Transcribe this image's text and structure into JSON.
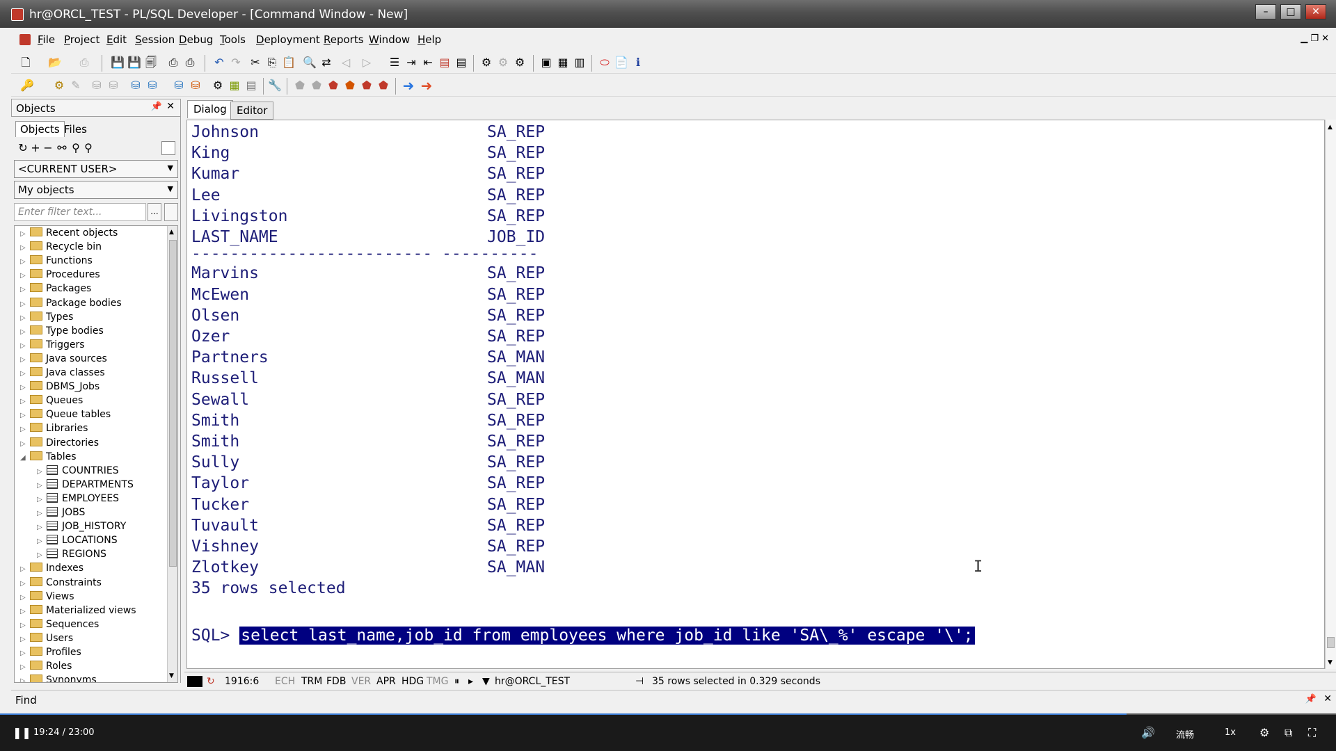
{
  "window": {
    "title": "hr@ORCL_TEST - PL/SQL Developer - [Command Window - New]"
  },
  "menu": [
    "File",
    "Project",
    "Edit",
    "Session",
    "Debug",
    "Tools",
    "Deployment",
    "Reports",
    "Window",
    "Help"
  ],
  "left_panel": {
    "title": "Objects",
    "tabs": [
      "Objects",
      "Files"
    ],
    "user_combo": "<CURRENT USER>",
    "scope_combo": "My objects",
    "filter_placeholder": "Enter filter text...",
    "filter_button": "...",
    "tree": [
      "Recent objects",
      "Recycle bin",
      "Functions",
      "Procedures",
      "Packages",
      "Package bodies",
      "Types",
      "Type bodies",
      "Triggers",
      "Java sources",
      "Java classes",
      "DBMS_Jobs",
      "Queues",
      "Queue tables",
      "Libraries",
      "Directories",
      "Tables"
    ],
    "tables": [
      "COUNTRIES",
      "DEPARTMENTS",
      "EMPLOYEES",
      "JOBS",
      "JOB_HISTORY",
      "LOCATIONS",
      "REGIONS"
    ],
    "tree_after": [
      "Indexes",
      "Constraints",
      "Views",
      "Materialized views",
      "Sequences",
      "Users",
      "Profiles",
      "Roles",
      "Synonyms"
    ]
  },
  "editor": {
    "tabs": [
      "Dialog",
      "Editor"
    ],
    "rows_top": [
      [
        "Johnson",
        "SA_REP"
      ],
      [
        "King",
        "SA_REP"
      ],
      [
        "Kumar",
        "SA_REP"
      ],
      [
        "Lee",
        "SA_REP"
      ],
      [
        "Livingston",
        "SA_REP"
      ]
    ],
    "header": [
      "LAST_NAME",
      "JOB_ID"
    ],
    "divider": "------------------------- ----------",
    "rows_bottom": [
      [
        "Marvins",
        "SA_REP"
      ],
      [
        "McEwen",
        "SA_REP"
      ],
      [
        "Olsen",
        "SA_REP"
      ],
      [
        "Ozer",
        "SA_REP"
      ],
      [
        "Partners",
        "SA_MAN"
      ],
      [
        "Russell",
        "SA_MAN"
      ],
      [
        "Sewall",
        "SA_REP"
      ],
      [
        "Smith",
        "SA_REP"
      ],
      [
        "Smith",
        "SA_REP"
      ],
      [
        "Sully",
        "SA_REP"
      ],
      [
        "Taylor",
        "SA_REP"
      ],
      [
        "Tucker",
        "SA_REP"
      ],
      [
        "Tuvault",
        "SA_REP"
      ],
      [
        "Vishney",
        "SA_REP"
      ],
      [
        "Zlotkey",
        "SA_MAN"
      ]
    ],
    "summary": "35 rows selected",
    "prompt": "SQL> ",
    "command": "select last_name,job_id from employees where job_id like 'SA\\_%' escape '\\';"
  },
  "status": {
    "position": "1916:6",
    "flags": [
      "ECH",
      "TRM",
      "FDB",
      "VER",
      "APR",
      "HDG",
      "TMG"
    ],
    "connection": "hr@ORCL_TEST",
    "message": "35 rows selected in 0.329 seconds"
  },
  "find": {
    "label": "Find"
  },
  "player": {
    "time": "19:24 / 23:00",
    "progress_fraction": 0.843,
    "quality": "流畅",
    "speed": "1x"
  }
}
